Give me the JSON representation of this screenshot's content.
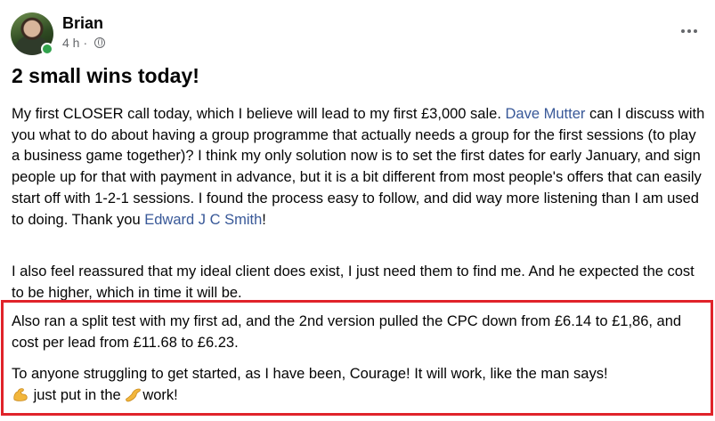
{
  "post": {
    "author": "Brian",
    "time": "4 h",
    "privacy_icon": "globe-icon",
    "more_icon": "more-options-icon",
    "title": "2 small wins today!",
    "p1_a": "My first CLOSER call today, which I believe will lead to my first £3,000 sale. ",
    "mention1": "Dave Mutter",
    "p1_b": " can I discuss with you what to do about having a group programme that actually needs a group for the first sessions (to play a business game together)? I think my only solution now is to set the first dates for early January, and sign people up for that with payment in advance, but it is a bit different from most people's offers that can easily start off with 1-2-1 sessions. I found the process easy to follow, and did way more listening than I am used to doing. Thank you ",
    "mention2": "Edward J C Smith",
    "p1_c": "!",
    "p2": "I also feel reassured that my ideal client does exist, I just need them to find me. And he expected the cost to be higher, which in time it will be.",
    "p3": "Also ran a split test with my first ad, and the 2nd version pulled the CPC down from £6.14 to £1,86, and cost per lead from £11.68 to £6.23.",
    "p4_a": "To anyone struggling to get started, as I have been, Courage! It will work, like the man says!",
    "p4_b": " just put in the ",
    "p4_c": "work!",
    "emoji1": "flexed-biceps",
    "emoji2": "flexed-biceps",
    "highlight_color": "#e0232a",
    "mention_color": "#385898"
  }
}
